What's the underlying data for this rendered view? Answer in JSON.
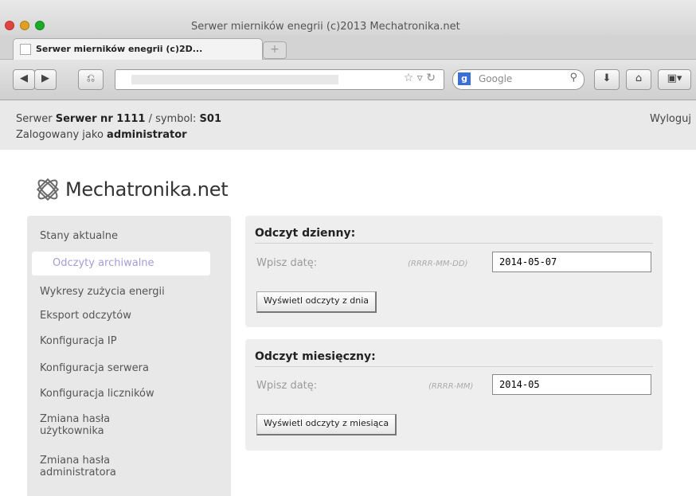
{
  "browser": {
    "window_title": "Serwer mierników enegrii (c)2013 Mechatronika.net",
    "tab_title": "Serwer mierników enegrii (c)2D...",
    "search_placeholder": "Google"
  },
  "header": {
    "server_prefix": "Serwer ",
    "server_name": "Serwer nr 1111",
    "symbol_prefix": " / symbol: ",
    "symbol": "S01",
    "logged_prefix": "Zalogowany jako ",
    "logged_user": "administrator",
    "logout_label": "Wyloguj"
  },
  "logo": {
    "text": "Mechatronika.net"
  },
  "sidebar": {
    "items": [
      {
        "label": "Stany aktualne"
      },
      {
        "label": "Odczyty archiwalne",
        "active": true
      },
      {
        "label": "Wykresy zużycia energii"
      },
      {
        "label": "Eksport odczytów"
      },
      {
        "label": "Konfiguracja IP"
      },
      {
        "label": "Konfiguracja serwera"
      },
      {
        "label": "Konfiguracja liczników"
      },
      {
        "label": "Zmiana hasła",
        "label2": "użytkownika"
      },
      {
        "label": "Zmiana hasła",
        "label2": "administratora"
      }
    ]
  },
  "daily": {
    "title": "Odczyt dzienny:",
    "label": "Wpisz datę:",
    "format": "(RRRR-MM-DD)",
    "value": "2014-05-07",
    "button": "Wyświetl odczyty z dnia"
  },
  "monthly": {
    "title": "Odczyt miesięczny:",
    "label": "Wpisz datę:",
    "format": "(RRRR-MM)",
    "value": "2014-05",
    "button": "Wyświetl odczyty z miesiąca"
  }
}
